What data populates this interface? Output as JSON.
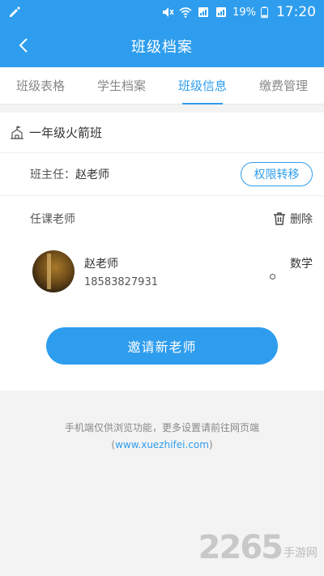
{
  "status_bar": {
    "battery": "19%",
    "time": "17:20",
    "icons": [
      "edit-icon",
      "mute-icon",
      "wifi-icon",
      "sim1-icon",
      "sim2-icon",
      "battery-icon"
    ]
  },
  "header": {
    "title": "班级档案",
    "back_icon": "chevron-left-icon"
  },
  "tabs": [
    {
      "label": "班级表格",
      "active": false
    },
    {
      "label": "学生档案",
      "active": false
    },
    {
      "label": "班级信息",
      "active": true
    },
    {
      "label": "缴费管理",
      "active": false
    }
  ],
  "class_info": {
    "class_name": "一年级火箭班",
    "head_teacher_label": "班主任：",
    "head_teacher_name": "赵老师",
    "transfer_label": "权限转移",
    "teachers_label": "任课老师",
    "delete_label": "删除"
  },
  "teachers": [
    {
      "name": "赵老师",
      "phone": "18583827931",
      "subject": "数学"
    }
  ],
  "invite_label": "邀请新老师",
  "footer": {
    "note": "手机端仅供浏览功能，更多设置请前往网页端",
    "link_open": "(",
    "link": "www.xuezhifei.com",
    "link_close": ")"
  },
  "watermark": {
    "number": "2265",
    "text": "手游网"
  },
  "colors": {
    "primary": "#2e9ded",
    "background": "#f3f3f3"
  }
}
